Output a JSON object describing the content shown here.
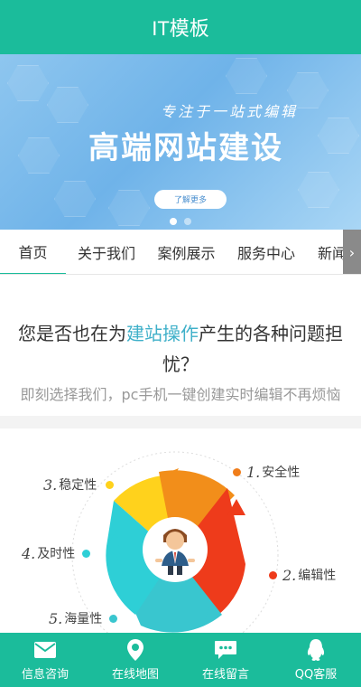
{
  "header": {
    "title": "IT模板"
  },
  "banner": {
    "subtitle": "专注于一站式编辑",
    "headline": "高端网站建设",
    "button_label": "了解更多",
    "slide_count": 2,
    "active_slide": 1
  },
  "tabs": [
    {
      "label": "首页",
      "active": true
    },
    {
      "label": "关于我们",
      "active": false
    },
    {
      "label": "案例展示",
      "active": false
    },
    {
      "label": "服务中心",
      "active": false
    },
    {
      "label": "新闻动",
      "active": false
    }
  ],
  "question": {
    "prefix": "您是否也在为",
    "highlight": "建站操作",
    "suffix": "产生的各种问题担忧？",
    "subtext": "即刻选择我们，pc手机一键创建实时编辑不再烦恼"
  },
  "features": [
    {
      "num": "1.",
      "label": "安全性",
      "color": "#f07d1a"
    },
    {
      "num": "2.",
      "label": "编辑性",
      "color": "#ee3b1b"
    },
    {
      "num": "3.",
      "label": "稳定性",
      "color": "#ffd21c"
    },
    {
      "num": "4.",
      "label": "及时性",
      "color": "#2ecfd6"
    },
    {
      "num": "5.",
      "label": "海量性",
      "color": "#39c6cf"
    }
  ],
  "bottom_nav": [
    {
      "label": "信息咨询",
      "icon": "mail-icon"
    },
    {
      "label": "在线地图",
      "icon": "map-pin-icon"
    },
    {
      "label": "在线留言",
      "icon": "chat-bubble-icon"
    },
    {
      "label": "QQ客服",
      "icon": "qq-penguin-icon"
    }
  ],
  "colors": {
    "brand": "#1bbc9b",
    "highlight": "#3fb0c9"
  }
}
